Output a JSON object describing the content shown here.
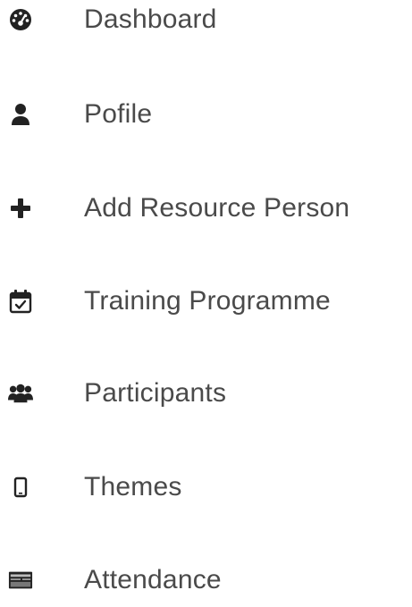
{
  "sidebar": {
    "items": [
      {
        "label": "Dashboard",
        "icon": "tachometer-icon"
      },
      {
        "label": "Pofile",
        "icon": "user-icon"
      },
      {
        "label": "Add Resource Person",
        "icon": "plus-icon"
      },
      {
        "label": "Training Programme",
        "icon": "calendar-check-icon"
      },
      {
        "label": "Participants",
        "icon": "users-icon"
      },
      {
        "label": "Themes",
        "icon": "mobile-icon"
      },
      {
        "label": "Attendance",
        "icon": "credit-card-icon"
      }
    ]
  },
  "colors": {
    "text": "#4a4a4a",
    "icon": "#222222",
    "background": "#ffffff"
  }
}
